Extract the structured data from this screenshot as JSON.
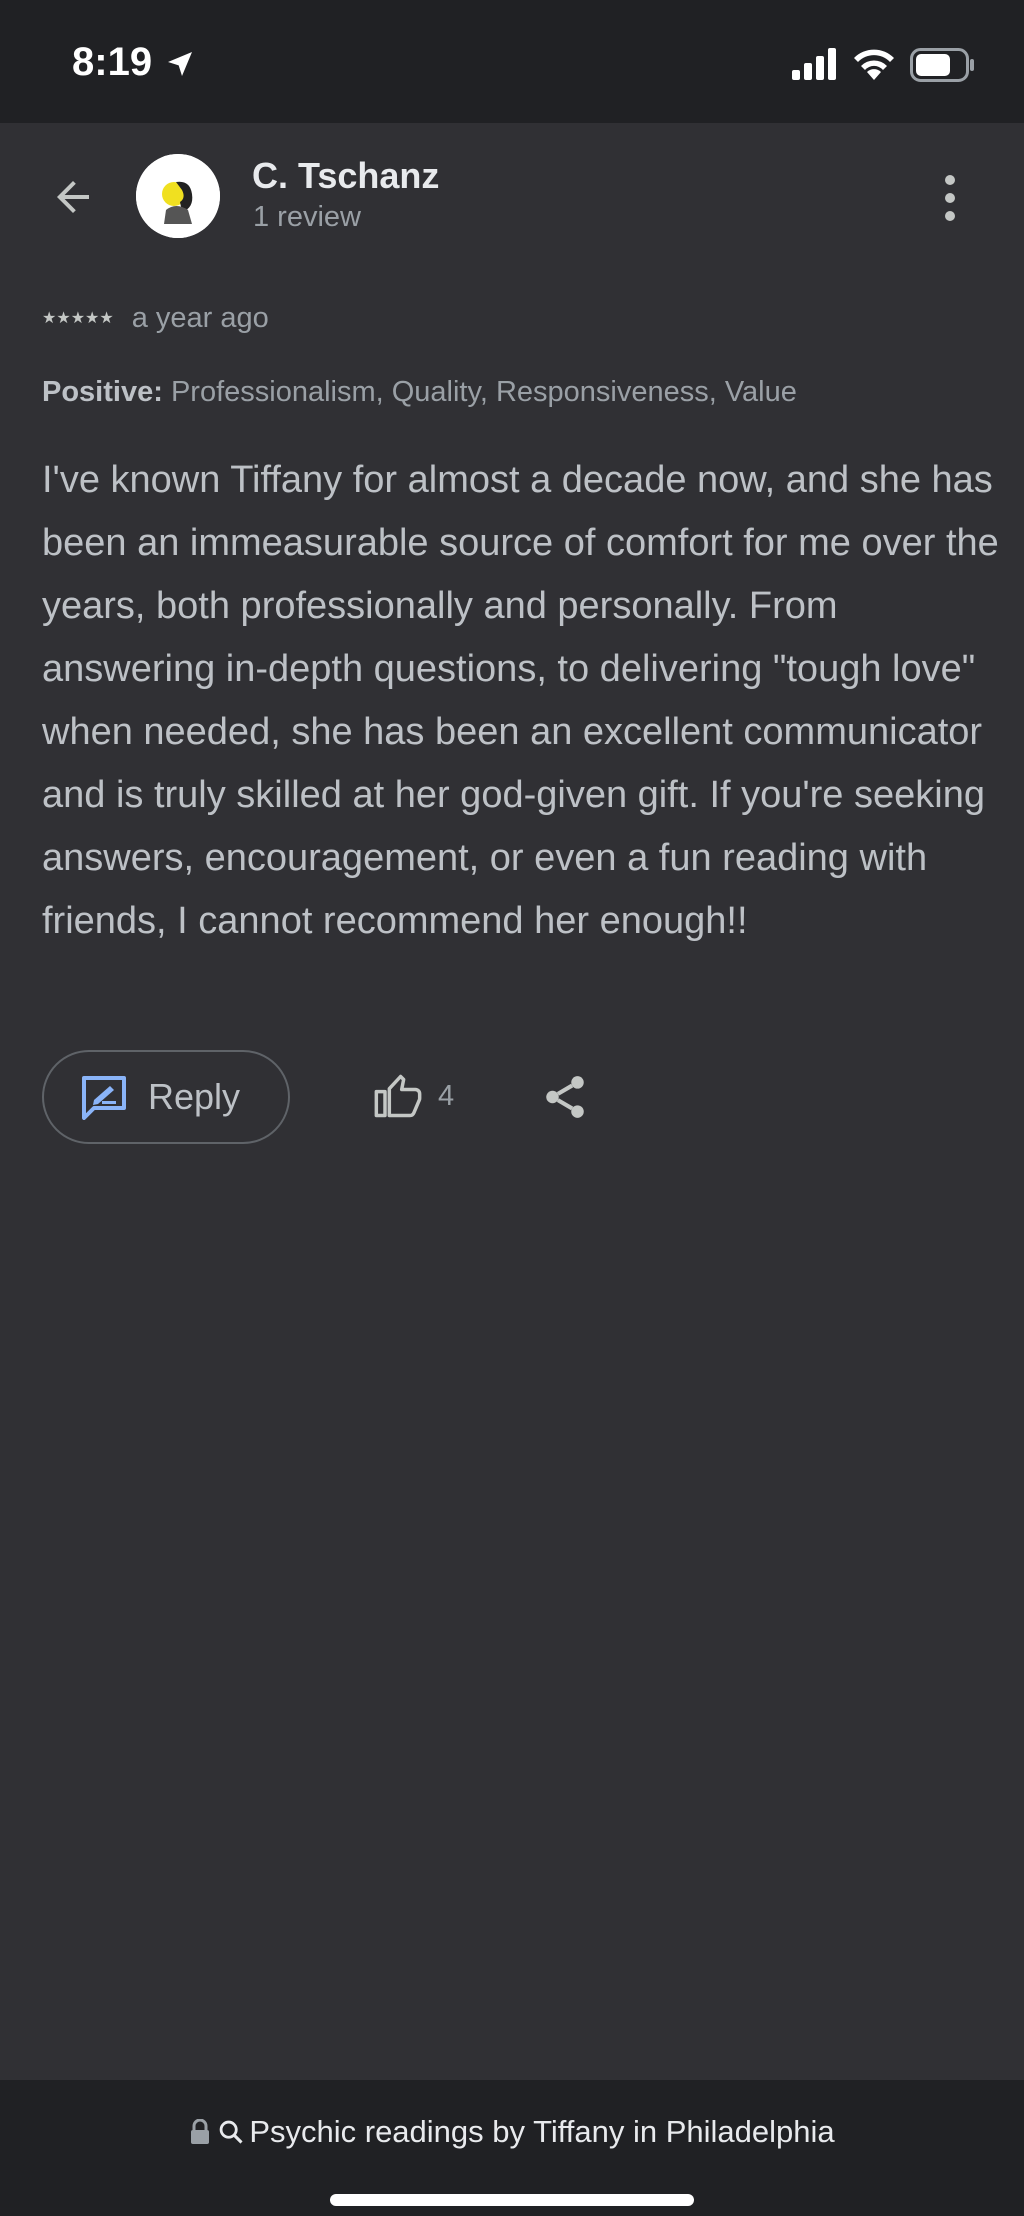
{
  "status_bar": {
    "time": "8:19"
  },
  "header": {
    "name": "C. Tschanz",
    "review_count": "1 review"
  },
  "rating": {
    "stars": "★★★★★",
    "value": 5,
    "time": "a year ago"
  },
  "positive": {
    "label": "Positive:",
    "items": "Professionalism, Quality, Responsiveness, Value"
  },
  "review": {
    "text": "I've known Tiffany for almost a decade now, and she has been an immeasurable source of comfort for me over the years, both professionally and personally. From answering in-depth questions, to delivering \"tough love\" when needed, she has been an excellent communicator and is truly skilled at her god-given gift. If you're seeking answers, encouragement, or even a fun reading with friends, I cannot recommend her enough!!"
  },
  "actions": {
    "reply_label": "Reply",
    "like_count": "4"
  },
  "bottom_bar": {
    "url_text": "Psychic readings by Tiffany in Philadelphia"
  },
  "colors": {
    "background": "#303034",
    "bars": "#202124",
    "star": "#fbbc04",
    "reply_icon": "#8ab4f8"
  },
  "icons": [
    "location-arrow-icon",
    "signal-icon",
    "wifi-icon",
    "battery-icon",
    "back-arrow-icon",
    "more-vert-icon",
    "reply-icon",
    "thumbs-up-icon",
    "share-icon",
    "lock-icon",
    "search-icon"
  ]
}
